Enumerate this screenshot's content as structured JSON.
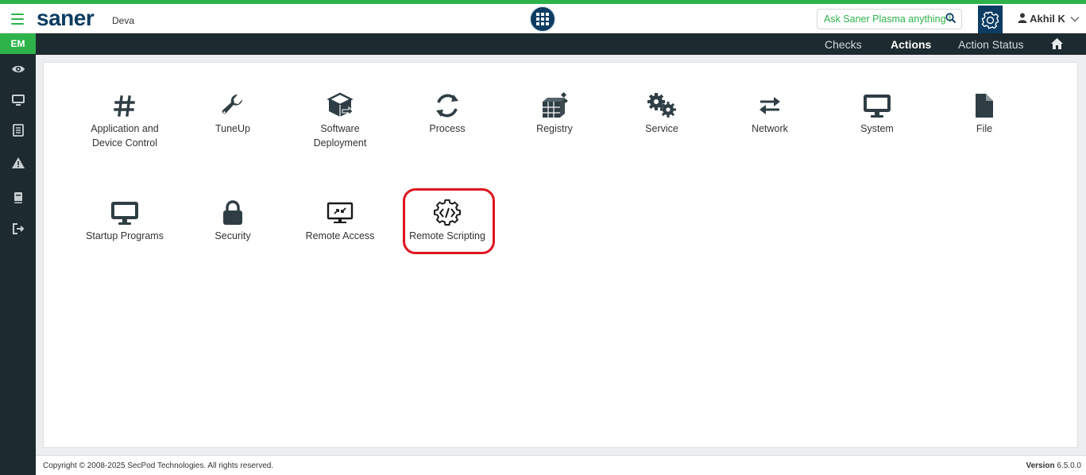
{
  "header": {
    "logo": "saner",
    "org": "Deva",
    "ask_placeholder": "Ask Saner Plasma anything !",
    "user_name": "Akhil K"
  },
  "sidebar": {
    "badge": "EM",
    "items": [
      {
        "icon": "eye-icon"
      },
      {
        "icon": "monitor-icon"
      },
      {
        "icon": "list-icon"
      },
      {
        "icon": "warning-icon"
      },
      {
        "icon": "book-icon"
      },
      {
        "icon": "logout-icon"
      }
    ]
  },
  "subnav": {
    "tabs": [
      {
        "label": "Checks",
        "active": false
      },
      {
        "label": "Actions",
        "active": true
      },
      {
        "label": "Action Status",
        "active": false
      }
    ]
  },
  "actions": {
    "row1": [
      {
        "label": "Application and\nDevice Control",
        "icon": "hash-icon"
      },
      {
        "label": "TuneUp",
        "icon": "wrench-icon"
      },
      {
        "label": "Software\nDeployment",
        "icon": "box-icon"
      },
      {
        "label": "Process",
        "icon": "refresh-icon"
      },
      {
        "label": "Registry",
        "icon": "cubes-icon"
      },
      {
        "label": "Service",
        "icon": "cogs-icon"
      },
      {
        "label": "Network",
        "icon": "exchange-icon"
      },
      {
        "label": "System",
        "icon": "desktop-icon"
      },
      {
        "label": "File",
        "icon": "file-icon"
      }
    ],
    "row2": [
      {
        "label": "Startup Programs",
        "icon": "desktop-icon"
      },
      {
        "label": "Security",
        "icon": "lock-icon"
      },
      {
        "label": "Remote Access",
        "icon": "remote-desktop-icon"
      },
      {
        "label": "Remote Scripting",
        "icon": "code-gear-icon"
      }
    ]
  },
  "footer": {
    "copyright": "Copyright © 2008-2025 SecPod Technologies. All rights reserved.",
    "version_label": "Version",
    "version_value": "6.5.0.0"
  },
  "colors": {
    "brand_green": "#2db34a",
    "brand_navy": "#0c3c62",
    "sidebar_bg": "#1d2a2f",
    "highlight_red": "#e0141e"
  }
}
